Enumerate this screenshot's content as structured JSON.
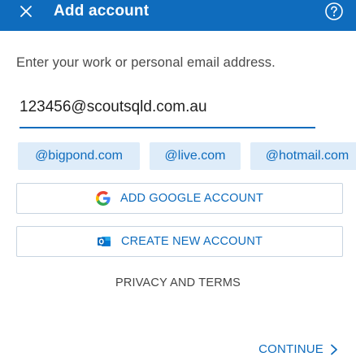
{
  "app_bar": {
    "title": "Add account",
    "close_icon": "close-icon",
    "help_icon": "help-circle-icon",
    "color": "#0f6cbd"
  },
  "form": {
    "prompt": "Enter your work or personal email address.",
    "email_value": "123456@scoutsqld.com.au",
    "suggestions": [
      "@bigpond.com",
      "@live.com",
      "@hotmail.com"
    ]
  },
  "buttons": {
    "google_label": "ADD GOOGLE ACCOUNT",
    "google_icon": "google-icon",
    "create_label": "CREATE NEW ACCOUNT",
    "create_icon": "outlook-icon",
    "privacy_label": "PRIVACY AND TERMS",
    "continue_label": "CONTINUE",
    "continue_icon": "chevron-right-icon"
  },
  "colors": {
    "accent": "#0f6cbd",
    "chip_background": "#deecf9"
  }
}
